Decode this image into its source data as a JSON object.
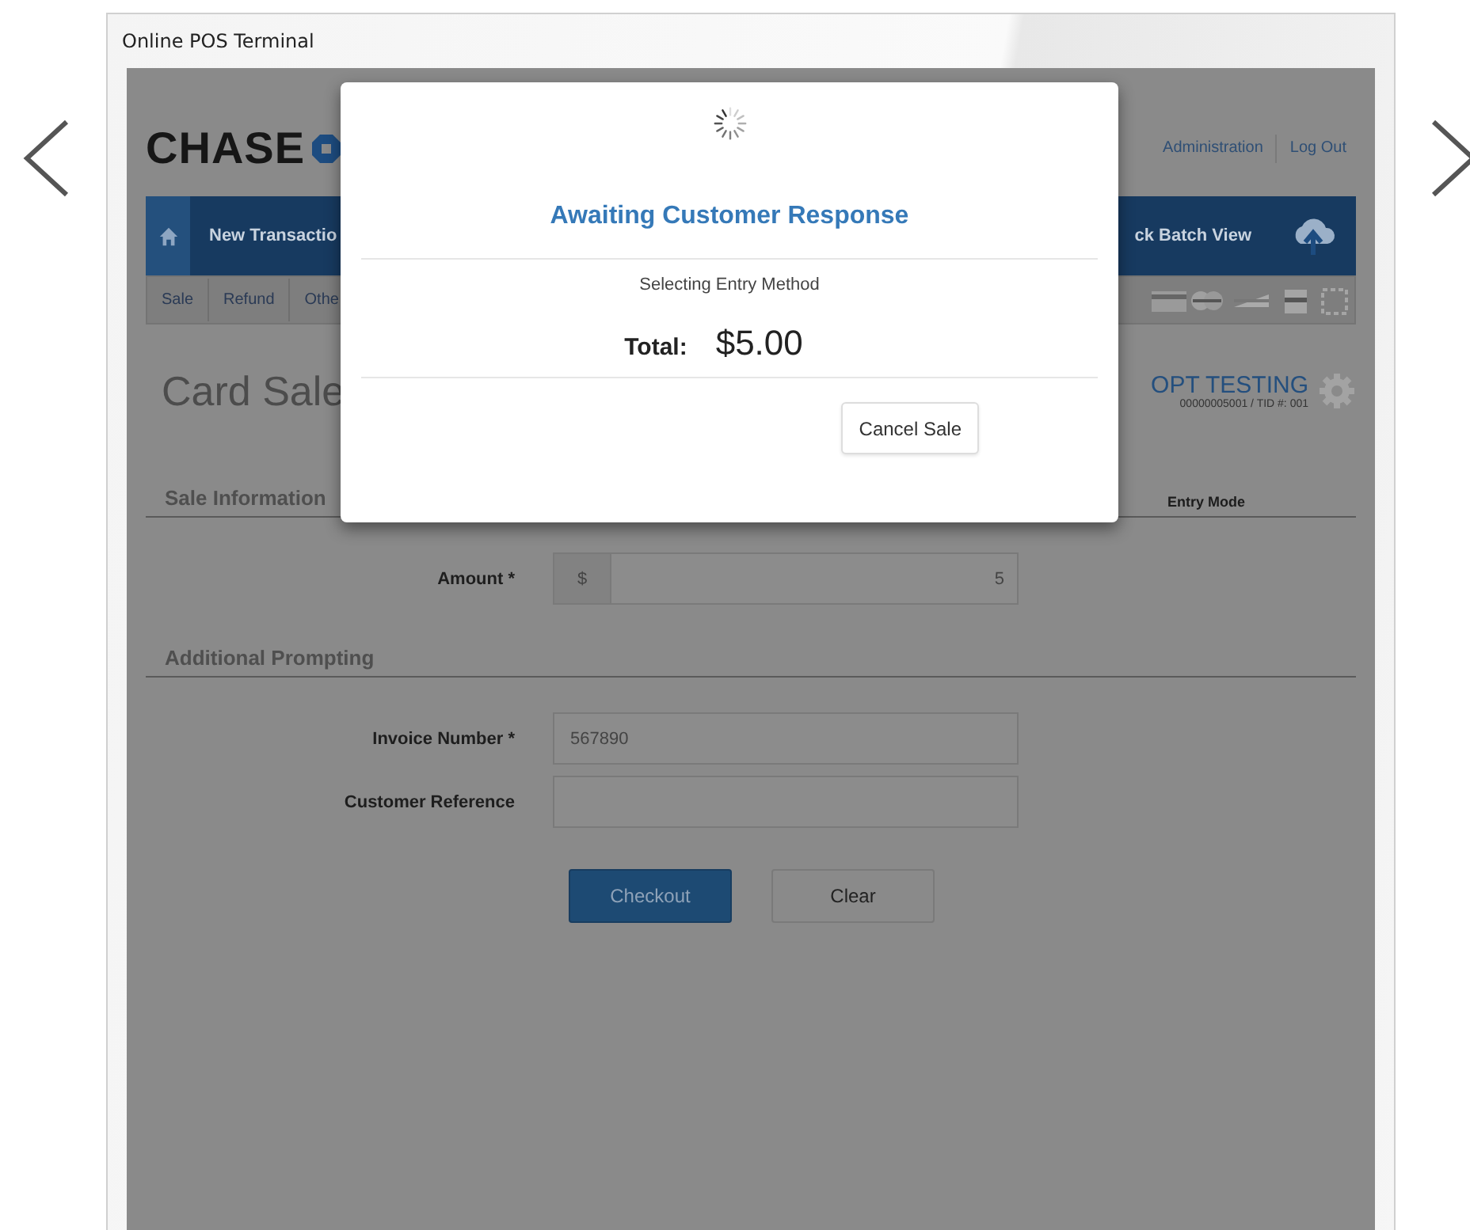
{
  "window": {
    "title": "Online POS Terminal"
  },
  "header": {
    "logo": "CHASE",
    "links": [
      "Administration",
      "Log Out"
    ]
  },
  "nav": {
    "left": [
      "New Transactio"
    ],
    "right": [
      "ck Batch View"
    ]
  },
  "subnav": {
    "items": [
      "Sale",
      "Refund",
      "Othe"
    ]
  },
  "page": {
    "title": "Card Sale",
    "merchant": "OPT TESTING",
    "merchant_ids": "00000005001 / TID #: 001"
  },
  "sections": [
    {
      "title": "Sale Information",
      "aside": "Entry Mode",
      "fields": [
        {
          "label": "Amount *",
          "kind": "currency",
          "prefix": "$",
          "value": "5"
        }
      ]
    },
    {
      "title": "Additional Prompting",
      "fields": [
        {
          "label": "Invoice Number *",
          "kind": "text",
          "value": "567890"
        },
        {
          "label": "Customer Reference",
          "kind": "text"
        }
      ]
    }
  ],
  "buttons": [
    {
      "label": "Checkout",
      "kind": "primary"
    },
    {
      "label": "Clear",
      "kind": "default"
    }
  ],
  "dialog": {
    "title": "Awaiting Customer Response",
    "status": "Selecting Entry Method",
    "total_label": "Total:",
    "total": "$5.00",
    "button": "Cancel Sale"
  }
}
